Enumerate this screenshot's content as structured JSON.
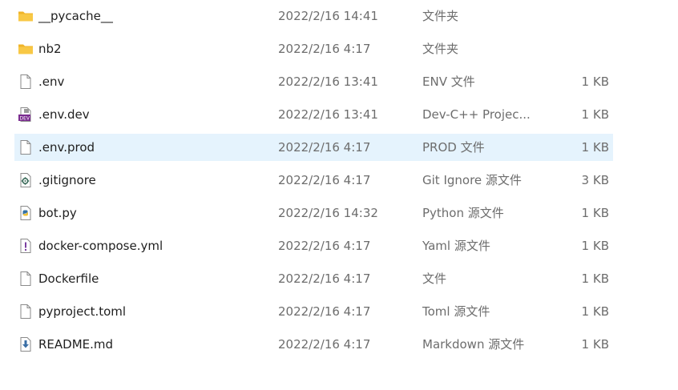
{
  "files": [
    {
      "name": "__pycache__",
      "date": "2022/2/16 14:41",
      "type": "文件夹",
      "size": "",
      "icon": "folder-icon"
    },
    {
      "name": "nb2",
      "date": "2022/2/16 4:17",
      "type": "文件夹",
      "size": "",
      "icon": "folder-icon"
    },
    {
      "name": ".env",
      "date": "2022/2/16 13:41",
      "type": "ENV 文件",
      "size": "1 KB",
      "icon": "blank-file-icon"
    },
    {
      "name": ".env.dev",
      "date": "2022/2/16 13:41",
      "type": "Dev-C++ Projec...",
      "size": "1 KB",
      "icon": "dev-cpp-file-icon"
    },
    {
      "name": ".env.prod",
      "date": "2022/2/16 4:17",
      "type": "PROD 文件",
      "size": "1 KB",
      "icon": "blank-file-icon",
      "selected": true
    },
    {
      "name": ".gitignore",
      "date": "2022/2/16 4:17",
      "type": "Git Ignore 源文件",
      "size": "3 KB",
      "icon": "gear-file-icon"
    },
    {
      "name": "bot.py",
      "date": "2022/2/16 14:32",
      "type": "Python 源文件",
      "size": "1 KB",
      "icon": "python-file-icon"
    },
    {
      "name": "docker-compose.yml",
      "date": "2022/2/16 4:17",
      "type": "Yaml 源文件",
      "size": "1 KB",
      "icon": "exclamation-file-icon"
    },
    {
      "name": "Dockerfile",
      "date": "2022/2/16 4:17",
      "type": "文件",
      "size": "1 KB",
      "icon": "blank-file-icon"
    },
    {
      "name": "pyproject.toml",
      "date": "2022/2/16 4:17",
      "type": "Toml 源文件",
      "size": "1 KB",
      "icon": "blank-file-icon"
    },
    {
      "name": "README.md",
      "date": "2022/2/16 4:17",
      "type": "Markdown 源文件",
      "size": "1 KB",
      "icon": "markdown-file-icon"
    }
  ],
  "colors": {
    "selected_row": "#e5f3fd",
    "folder": "#f8c845",
    "secondary_text": "#6d6d6d"
  }
}
